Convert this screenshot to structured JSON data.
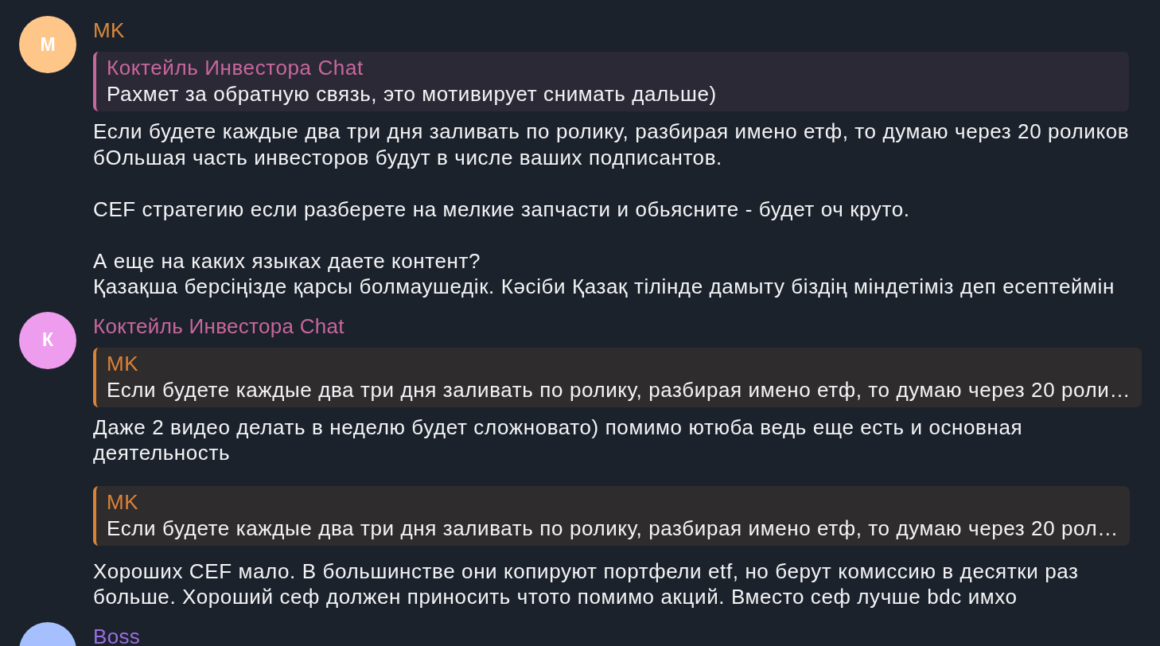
{
  "messages": [
    {
      "author": "MK",
      "color": "#dc8a3c",
      "avatar": {
        "letter": "M",
        "color": "#ffc68a"
      },
      "parts": [
        {
          "reply": {
            "author": "Коктейль Инвестора Chat",
            "color": "#c8679c",
            "text": "Рахмет за обратную связь, это мотивирует снимать дальше)"
          },
          "paragraphs": [
            "Если будете каждые два три дня заливать по ролику, разбирая имено етф, то думаю через 20 роликов\nбОльшая часть инвесторов будут в числе ваших подписантов.",
            "CEF стратегию если разберете на мелкие запчасти и обьясните - будет оч круто.",
            "А еще на каких языках даете контент?\nҚазақша берсіңізде қарсы болмаушедік. Кәсіби Қазақ тілінде дамыту біздің міндетіміз деп есептеймін"
          ]
        }
      ]
    },
    {
      "author": "Коктейль Инвестора Chat",
      "color": "#c8679c",
      "avatar": {
        "letter": "К",
        "color": "#ee9cee"
      },
      "parts": [
        {
          "reply": {
            "author": "MK",
            "color": "#dc8236",
            "text": "Если будете каждые два три дня заливать по ролику, разбирая имено етф, то думаю через 20 роли…"
          },
          "paragraphs": [
            "Даже 2 видео делать в неделю будет сложновато) помимо ютюба ведь еще есть и основная\nдеятельность"
          ]
        },
        {
          "reply": {
            "author": "MK",
            "color": "#dc8236",
            "text": "Если будете каждые два три дня заливать по ролику, разбирая имено етф, то думаю через 20 рол…"
          },
          "paragraphs": [
            "Хороших CEF мало. В большинстве они копируют портфели etf, но берут комиссию в десятки раз\nбольше. Хороший сеф должен приносить чтото помимо акций. Вместо сеф лучше bdc имхо"
          ]
        }
      ]
    },
    {
      "author": "Boss",
      "color": "#9a6ee0",
      "avatar": {
        "color": "#a6c0ff"
      }
    }
  ]
}
